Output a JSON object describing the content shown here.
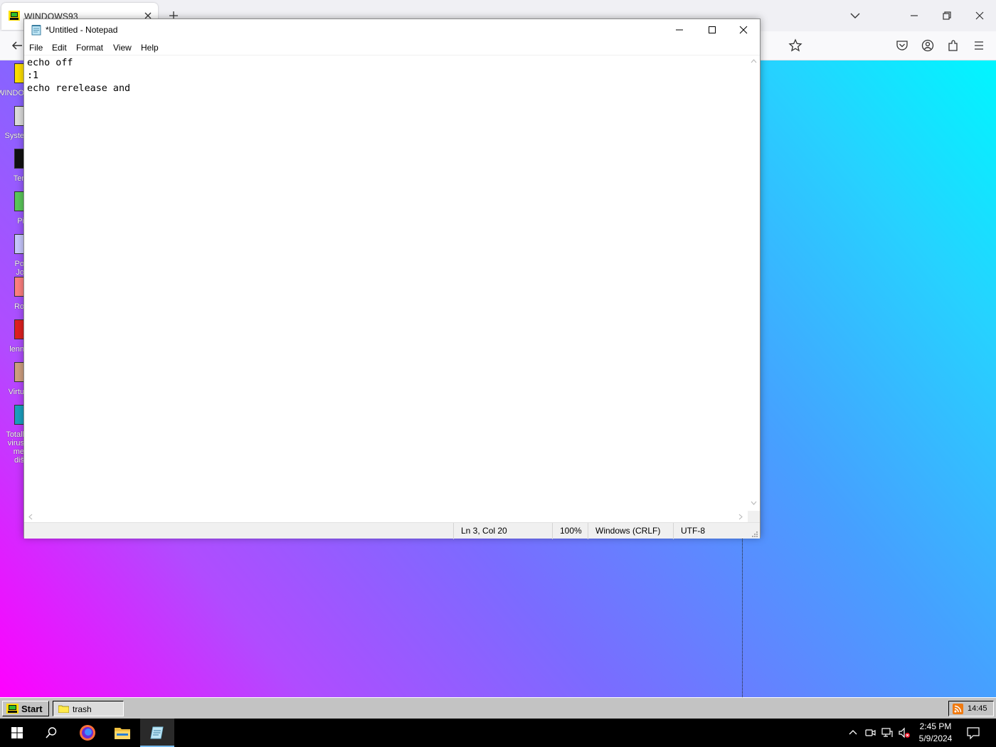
{
  "browser": {
    "tab_title": "WINDOWS93",
    "tab_icon": "windows93-logo-icon",
    "colors": {
      "tabbar": "#f0f0f4",
      "navbar": "#f9f9fb"
    }
  },
  "desktop": {
    "icons": [
      {
        "name": "windows93",
        "label": "WINDO"
      },
      {
        "name": "system",
        "label": "Syste"
      },
      {
        "name": "terminal",
        "label": "Ter"
      },
      {
        "name": "piskel",
        "label": "Pi"
      },
      {
        "name": "poly-joe",
        "label": "Po\nJo"
      },
      {
        "name": "robby",
        "label": "Ro"
      },
      {
        "name": "lenna",
        "label": "lenn"
      },
      {
        "name": "virtual-pc",
        "label": "Virtu"
      },
      {
        "name": "total-virus",
        "label": "Totall\nvirus\nme\ndiš"
      }
    ],
    "gradient": [
      "#ff00ff",
      "#7a6cff",
      "#00f6ff"
    ]
  },
  "notepad": {
    "title": "*Untitled - Notepad",
    "menu": [
      "File",
      "Edit",
      "Format",
      "View",
      "Help"
    ],
    "content": "echo off\n:1\necho rerelease and",
    "status": {
      "position": "Ln 3, Col 20",
      "zoom": "100%",
      "line_ending": "Windows (CRLF)",
      "encoding": "UTF-8"
    }
  },
  "w93_taskbar": {
    "start_label": "Start",
    "task_label": "trash",
    "tray_time": "14:45"
  },
  "win_taskbar": {
    "time": "2:45 PM",
    "date": "5/9/2024",
    "accent": "#76b9ed"
  }
}
